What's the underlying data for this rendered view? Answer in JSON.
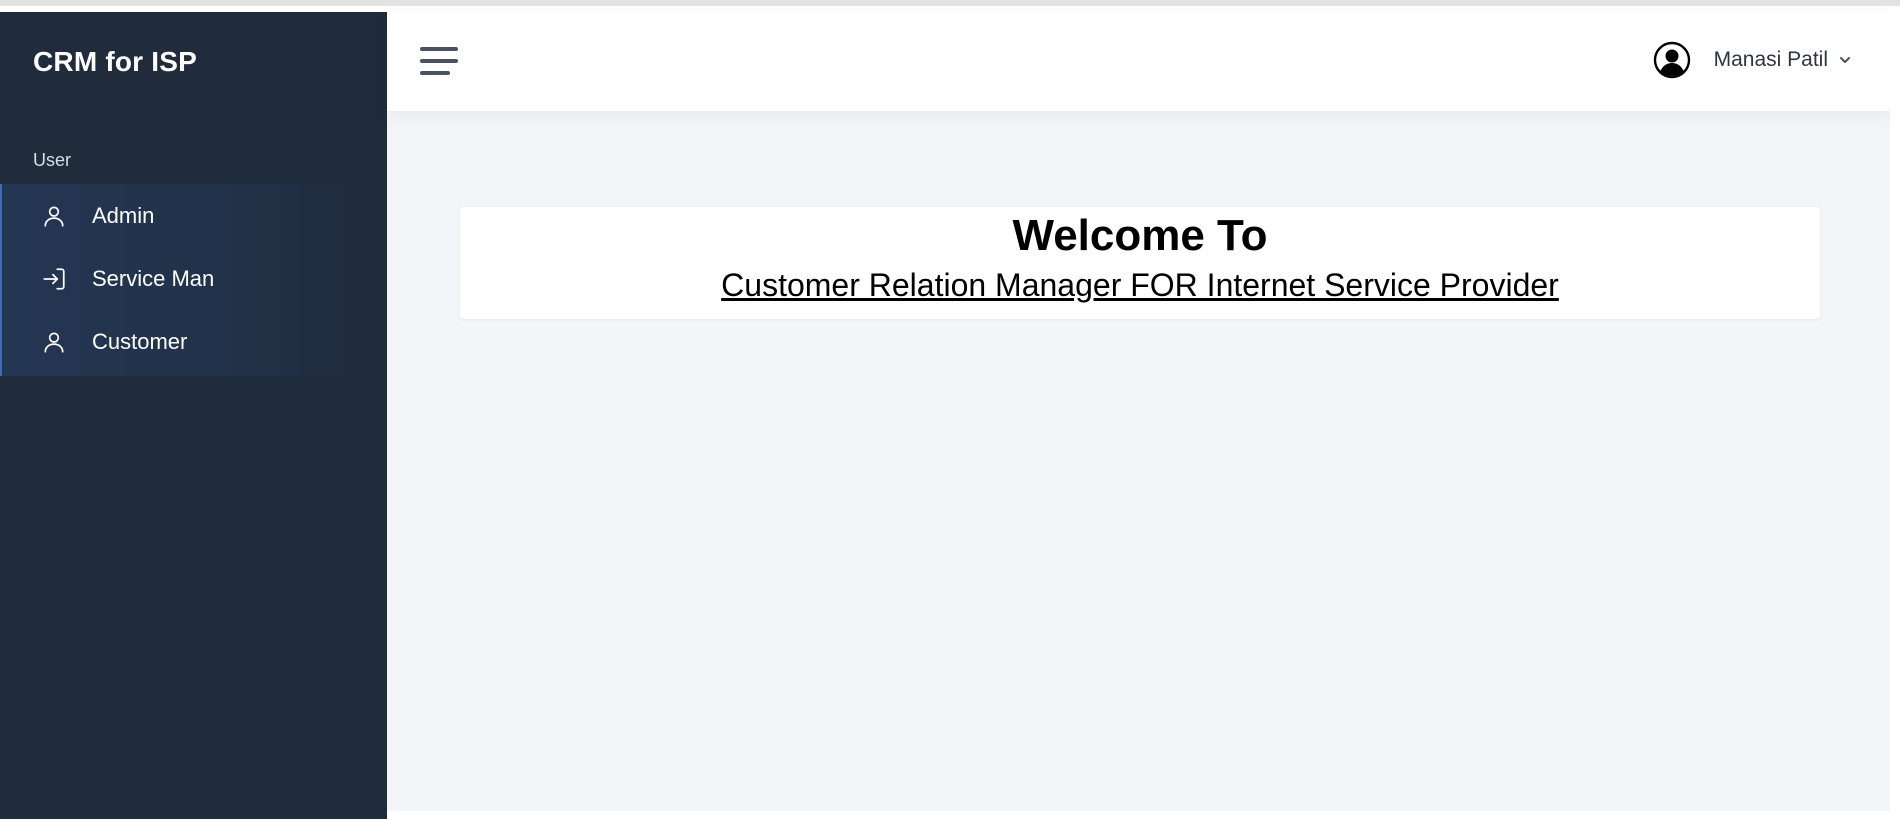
{
  "sidebar": {
    "brand": "CRM for ISP",
    "section_label": "User",
    "items": [
      {
        "label": "Admin",
        "icon": "user-icon"
      },
      {
        "label": "Service Man",
        "icon": "login-icon"
      },
      {
        "label": "Customer",
        "icon": "user-icon"
      }
    ]
  },
  "header": {
    "menu_icon": "hamburger-menu-icon",
    "user_name": "Manasi Patil",
    "avatar_icon": "user-circle-icon",
    "dropdown_icon": "chevron-down-icon"
  },
  "main": {
    "welcome_title": "Welcome To",
    "welcome_subtitle": "Customer Relation Manager FOR Internet Service Provider"
  },
  "colors": {
    "sidebar_bg": "#202b3b",
    "active_accent": "#3a69b8",
    "content_bg": "#f4f5f9",
    "card_bg": "#ffffff"
  }
}
